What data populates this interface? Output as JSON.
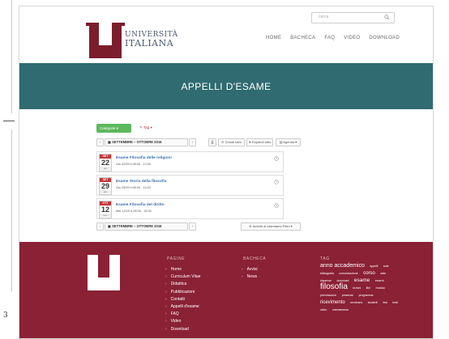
{
  "header": {
    "search_placeholder": "cerca",
    "logo_line1": "UNIVERSITÀ",
    "logo_line2": "ITALIANA",
    "nav": [
      "HOME",
      "BACHECA",
      "FAQ",
      "VIDEO",
      "DOWNLOAD"
    ]
  },
  "banner": {
    "title": "APPELLI D'ESAME"
  },
  "filters": {
    "category": "Categorie",
    "tag": "Tag"
  },
  "calendar": {
    "prev": "‹",
    "range": "SETTEMBRE – OTTOBRE 2016",
    "next": "›",
    "print": "⎙",
    "expand_all": "Espandi tutto",
    "collapse_all": "Chiudi tutto",
    "agenda": "Agenda"
  },
  "events": [
    {
      "month": "SET",
      "day": "22",
      "weekday": "gio",
      "title": "Esame Filosofia delle religioni",
      "time": "Gio 22/09 h.09:00 - 13:00"
    },
    {
      "month": "SET",
      "day": "29",
      "weekday": "gio",
      "title": "Esame Storia della filosofia",
      "time": "Gio 29/09 h.09:00 - 11:00"
    },
    {
      "month": "OTT",
      "day": "12",
      "weekday": "mer",
      "title": "Esame Filosofia del diritto",
      "time": "Mer 12/10 h.09:00 - 13:00"
    }
  ],
  "bottom": {
    "prev": "‹",
    "range": "SETTEMBRE – OTTOBRE 2016",
    "next": "›",
    "subscribe": "Iscriviti al calendario Filtro"
  },
  "footer": {
    "col1_title": "PAGINE",
    "col1_items": [
      "Home",
      "Curriculum Vitae",
      "Didattica",
      "Pubblicazioni",
      "Contatti",
      "Appelli d'esame",
      "FAQ",
      "Video",
      "Download"
    ],
    "col2_title": "BACHECA",
    "col2_items": [
      "Avvisi",
      "News"
    ],
    "col3_title": "TAG",
    "tags": [
      "anno accademico",
      "appelli",
      "aule",
      "bibliografia",
      "comunicazione",
      "corso",
      "date",
      "dispense",
      "download",
      "esame",
      "esami",
      "filosofia",
      "lezioni",
      "libri",
      "modulo",
      "prenotazione",
      "presenze",
      "programma",
      "ricevimento",
      "seminario",
      "studenti",
      "tesi",
      "testi",
      "video",
      "orientamento"
    ]
  },
  "colors": {
    "brand_red": "#7c1d2c",
    "banner_teal": "#2f6b71",
    "footer_red": "#8a2135",
    "category_green": "#5cb85c"
  }
}
